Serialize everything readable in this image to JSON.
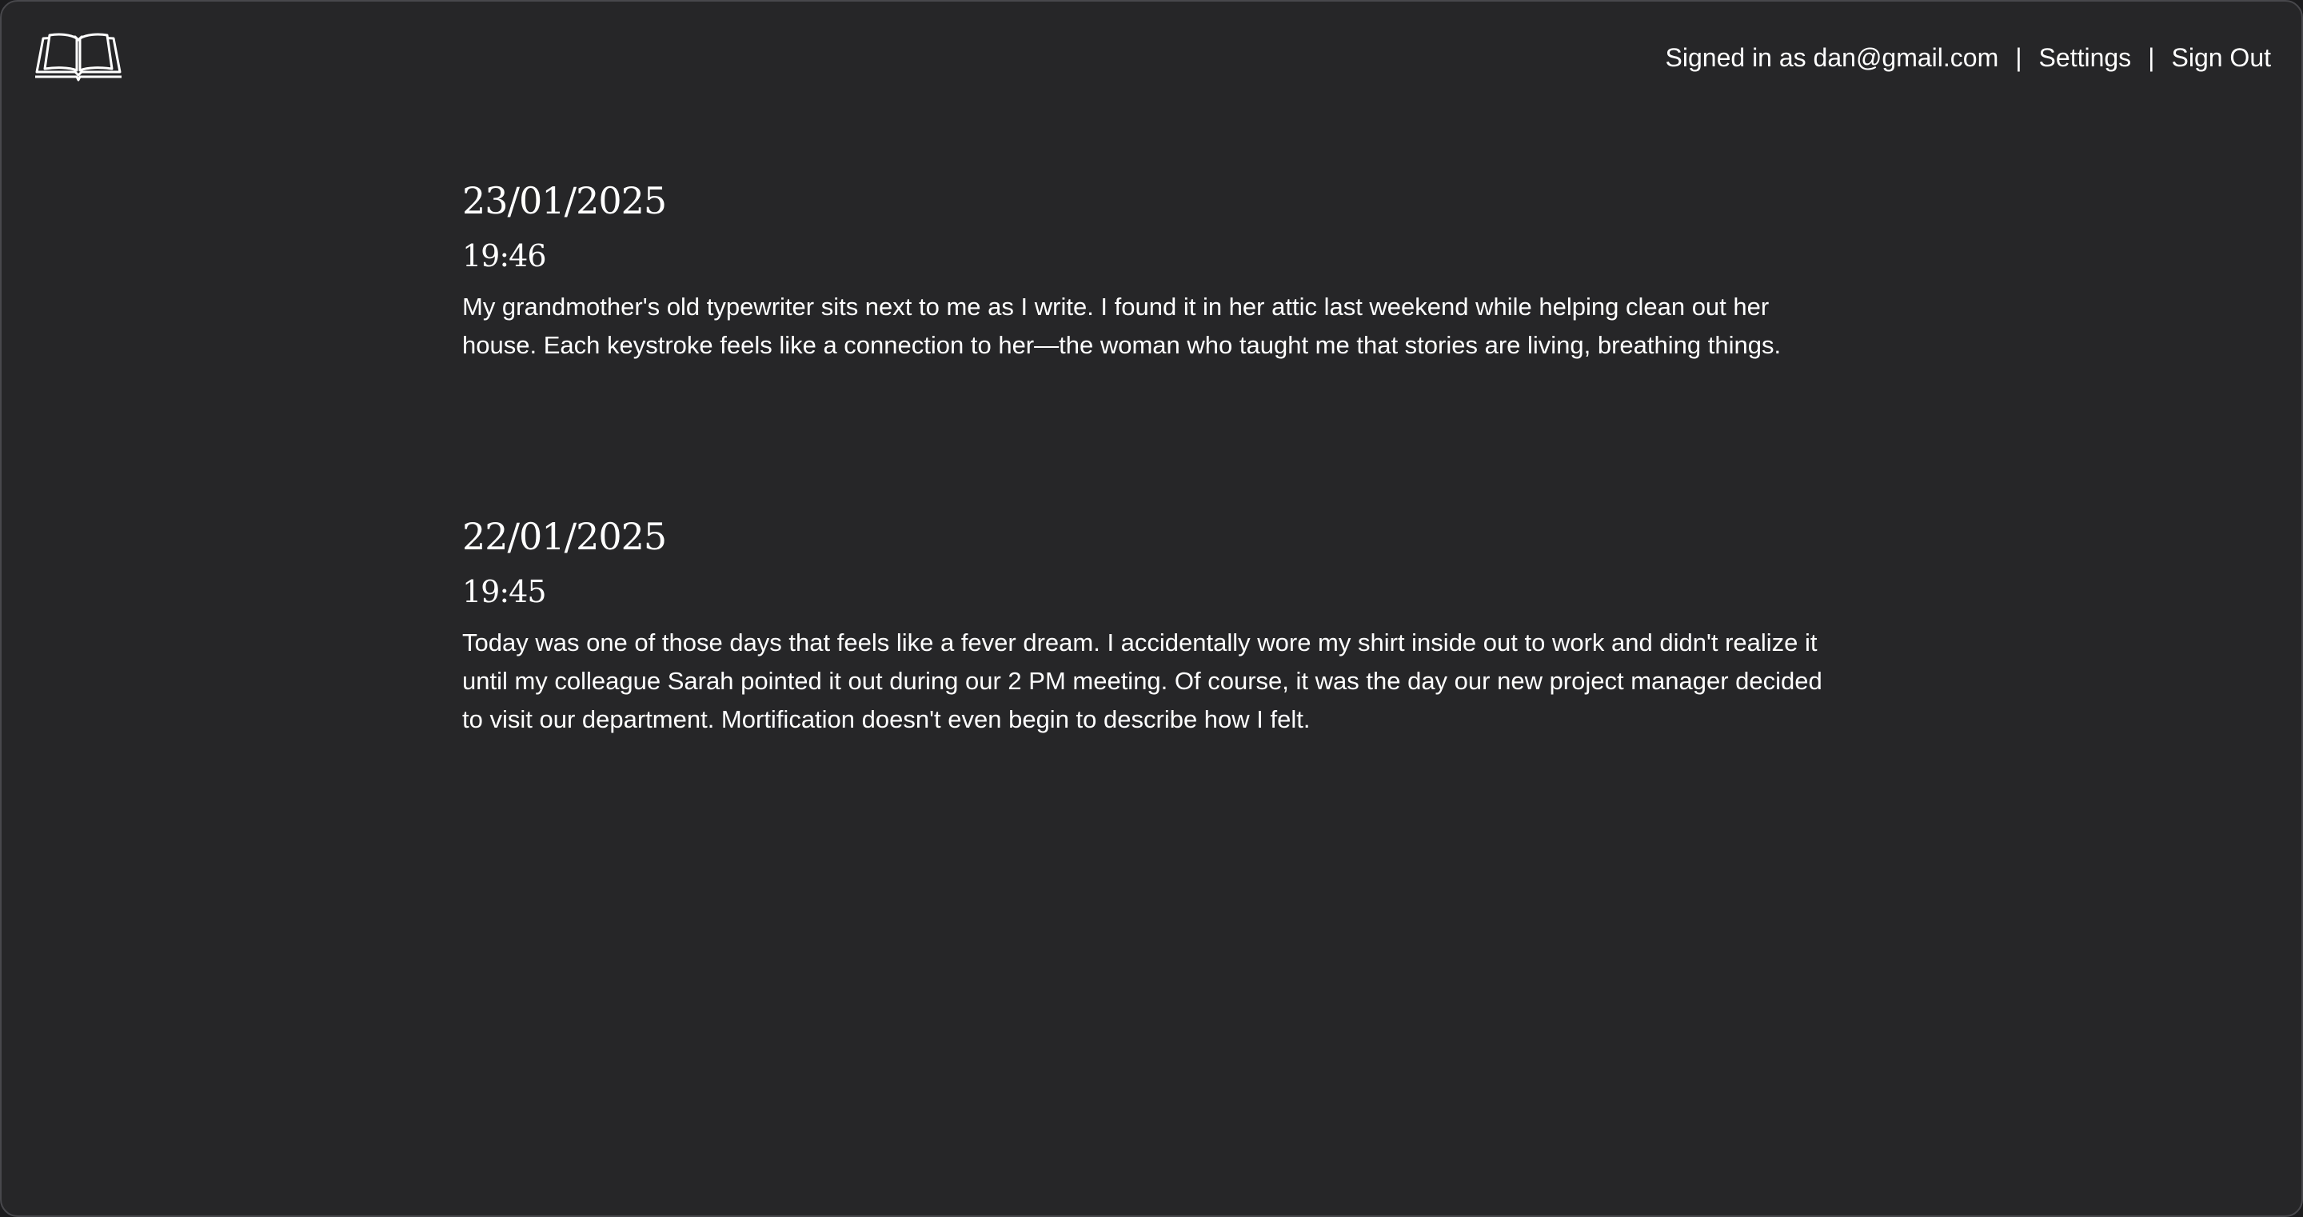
{
  "app": {
    "logo_icon": "open-book-icon"
  },
  "header": {
    "signed_in_text": "Signed in as dan@gmail.com",
    "separator": "|",
    "settings_label": "Settings",
    "sign_out_label": "Sign Out"
  },
  "entries": [
    {
      "date": "23/01/2025",
      "time": "19:46",
      "body": "My grandmother's old typewriter sits next to me as I write. I found it in her attic last weekend while helping clean out her house. Each keystroke feels like a connection to her—the woman who taught me that stories are living, breathing things."
    },
    {
      "date": "22/01/2025",
      "time": "19:45",
      "body": "Today was one of those days that feels like a fever dream. I accidentally wore my shirt inside out to work and didn't realize it until my colleague Sarah pointed it out during our 2 PM meeting. Of course, it was the day our new project manager decided to visit our department. Mortification doesn't even begin to describe how I felt."
    }
  ]
}
